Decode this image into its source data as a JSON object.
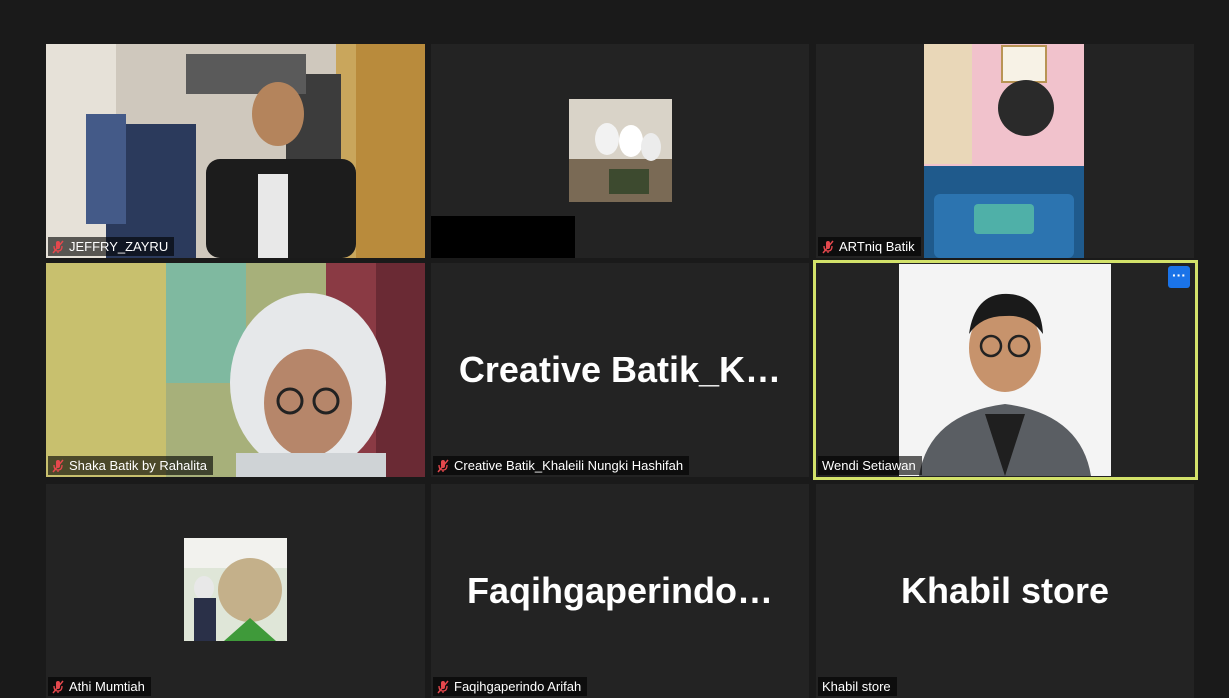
{
  "meeting": {
    "participants": [
      {
        "id": "p1",
        "name": "JEFFRY_ZAYRU",
        "muted": true,
        "display": "video"
      },
      {
        "id": "p2",
        "name": "",
        "muted": false,
        "display": "thumbnail"
      },
      {
        "id": "p3",
        "name": "ARTniq Batik",
        "muted": true,
        "display": "video"
      },
      {
        "id": "p4",
        "name": "Shaka Batik by Rahalita",
        "muted": true,
        "display": "video"
      },
      {
        "id": "p5",
        "name": "Creative Batik_Khaleili Nungki Hashifah",
        "big_name": "Creative  Batik_K…",
        "muted": true,
        "display": "name"
      },
      {
        "id": "p6",
        "name": "Wendi Setiawan",
        "muted": false,
        "display": "video",
        "active_speaker": true,
        "more_label": "···"
      },
      {
        "id": "p7",
        "name": "Athi Mumtiah",
        "muted": true,
        "display": "thumbnail"
      },
      {
        "id": "p8",
        "name": "Faqihgaperindo Arifah",
        "big_name": "Faqihgaperindo…",
        "muted": true,
        "display": "name"
      },
      {
        "id": "p9",
        "name": "Khabil store",
        "big_name": "Khabil store",
        "muted": false,
        "display": "name"
      }
    ]
  },
  "colors": {
    "background": "#1a1a1a",
    "tile": "#232323",
    "active_border": "#d3e26a",
    "mute_icon": "#e5484d",
    "more_button": "#1a73e8"
  }
}
